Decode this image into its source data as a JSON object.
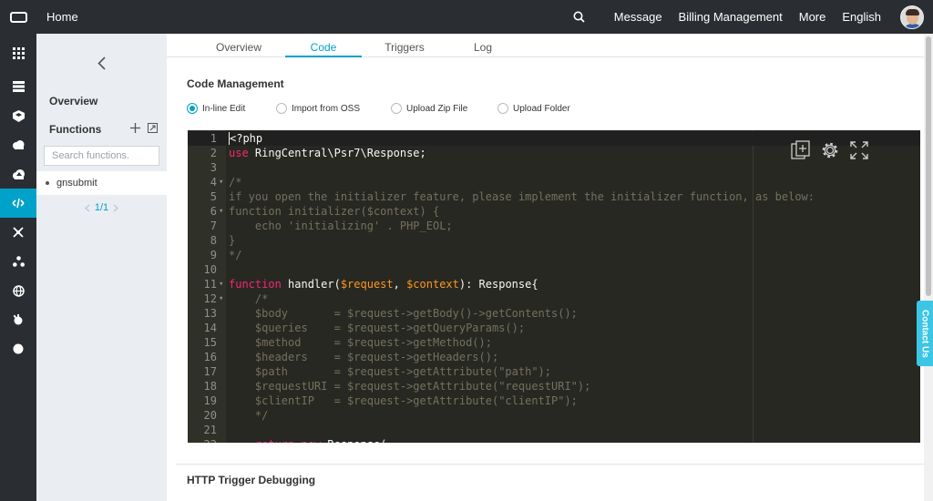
{
  "topbar": {
    "home": "Home",
    "message": "Message",
    "billing": "Billing Management",
    "more": "More",
    "language": "English"
  },
  "panel": {
    "overview": "Overview",
    "functions_title": "Functions",
    "search_placeholder": "Search functions.",
    "functions": [
      "gnsubmit"
    ],
    "pager": "1/1"
  },
  "tabs": [
    "Overview",
    "Code",
    "Triggers",
    "Log"
  ],
  "active_tab": "Code",
  "code_management": {
    "title": "Code Management",
    "options": [
      "In-line Edit",
      "Import from OSS",
      "Upload Zip File",
      "Upload Folder"
    ],
    "selected": "In-line Edit"
  },
  "editor": {
    "lines": [
      "<?php",
      "use RingCentral\\Psr7\\Response;",
      "",
      "/*",
      "if you open the initializer feature, please implement the initializer function, as below:",
      "function initializer($context) {",
      "    echo 'initializing' . PHP_EOL;",
      "}",
      "*/",
      "",
      "function handler($request, $context): Response{",
      "    /*",
      "    $body       = $request->getBody()->getContents();",
      "    $queries    = $request->getQueryParams();",
      "    $method     = $request->getMethod();",
      "    $headers    = $request->getHeaders();",
      "    $path       = $request->getAttribute(\"path\");",
      "    $requestURI = $request->getAttribute(\"requestURI\");",
      "    $clientIP   = $request->getAttribute(\"clientIP\");",
      "    */",
      "",
      "    return new Response("
    ]
  },
  "http_trigger": "HTTP Trigger Debugging",
  "contact": "Contact Us",
  "colors": {
    "accent": "#00a2ca",
    "topbar": "#2a2d32",
    "editor_bg": "#272822"
  }
}
